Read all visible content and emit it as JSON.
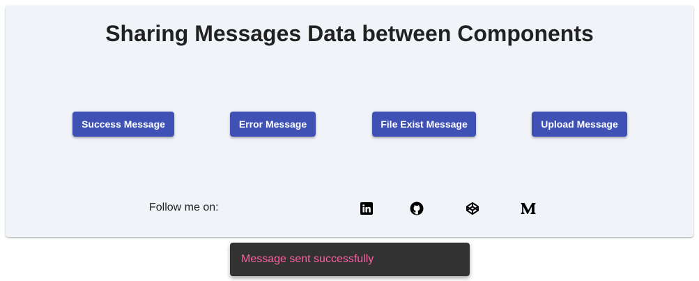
{
  "page": {
    "title": "Sharing Messages Data between Components"
  },
  "buttons": {
    "success": "Success Message",
    "error": "Error Message",
    "file_exist": "File Exist Message",
    "upload": "Upload Message"
  },
  "footer": {
    "follow_label": "Follow me on:",
    "social": [
      {
        "icon": "linkedin-icon"
      },
      {
        "icon": "github-icon"
      },
      {
        "icon": "codepen-icon"
      },
      {
        "icon": "medium-icon"
      }
    ]
  },
  "snackbar": {
    "message": "Message sent successfully"
  },
  "colors": {
    "card_background": "#f0f4f8",
    "button_primary": "#3f51b5",
    "snackbar_background": "#323232",
    "snackbar_text": "#ff5fa2"
  }
}
